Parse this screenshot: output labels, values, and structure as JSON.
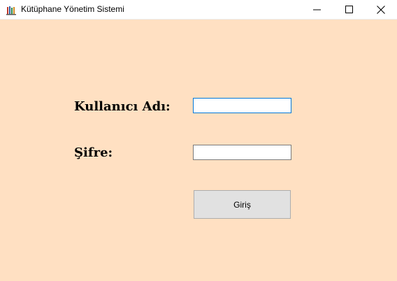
{
  "window": {
    "title": "Kütüphane Yönetim Sistemi",
    "app_icon": "books-icon",
    "controls": {
      "minimize": "minimize-icon",
      "maximize": "maximize-icon",
      "close": "close-icon"
    }
  },
  "form": {
    "username_label": "Kullanıcı Adı:",
    "username_value": "",
    "password_label": "Şifre:",
    "password_value": "",
    "login_button": "Giriş"
  },
  "colors": {
    "background": "#ffe0c2",
    "button_face": "#e1e1e1",
    "focus_border": "#0078d7"
  }
}
